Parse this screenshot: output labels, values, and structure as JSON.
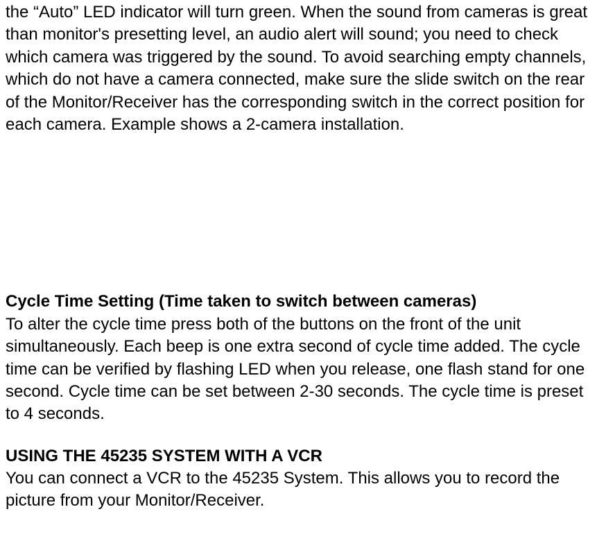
{
  "paragraphs": {
    "p1": "the “Auto” LED indicator will turn green. When the sound from cameras is great than monitor's presetting level, an audio alert will sound; you need to check which camera was triggered by the sound. To avoid searching empty channels, which do not have a camera connected, make sure the slide switch on the rear of the Monitor/Receiver has the corresponding switch in the correct position for each camera. Example shows a 2-camera installation.",
    "h1": "Cycle Time Setting (Time taken to switch between cameras)",
    "p2": "To alter the cycle time press both of the buttons on the front of the unit simultaneously. Each beep is one extra second of cycle time added. The cycle time can be verified by flashing LED when you release, one flash stand for one second. Cycle time can be set between 2-30 seconds. The cycle time is preset to 4 seconds.",
    "h2": "USING THE 45235 SYSTEM WITH A VCR",
    "p3": "You can connect a VCR to the 45235 System. This allows you to record the picture from your Monitor/Receiver."
  }
}
